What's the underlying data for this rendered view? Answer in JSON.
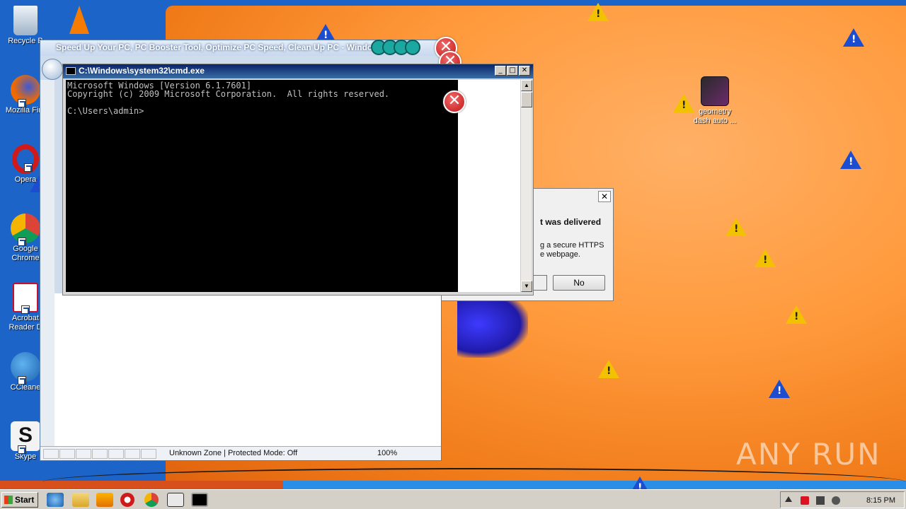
{
  "desktop": {
    "icons": [
      {
        "label": "Recycle B",
        "name": "recycle-bin"
      },
      {
        "label": "Mozilla Fire",
        "name": "firefox"
      },
      {
        "label": "Opera",
        "name": "opera"
      },
      {
        "label": "Google Chrome",
        "name": "chrome"
      },
      {
        "label": "Acrobat Reader D",
        "name": "acrobat"
      },
      {
        "label": "CCleane",
        "name": "ccleaner"
      },
      {
        "label": "Skype",
        "name": "skype"
      },
      {
        "label": "geometry dash auto ...",
        "name": "geometry-dash"
      }
    ]
  },
  "ie_window": {
    "title": "Speed Up Your PC, PC Booster Tool, Optimize PC Speed, Clean Up PC - Windows In",
    "status_zone": "Unknown Zone | Protected Mode: Off",
    "zoom": "100%"
  },
  "cmd_window": {
    "title": "C:\\Windows\\system32\\cmd.exe",
    "line1": "Microsoft Windows [Version 6.1.7601]",
    "line2": "Copyright (c) 2009 Microsoft Corporation.  All rights reserved.",
    "line3": "",
    "line4": "C:\\Users\\admin>"
  },
  "dialog": {
    "heading": "t was delivered",
    "text_line1": "g a secure HTTPS",
    "text_line2": "e webpage.",
    "no_label": "No",
    "close_glyph": "✕"
  },
  "taskbar": {
    "start_label": "Start",
    "clock": "8:15 PM"
  },
  "watermark": "ANY RUN",
  "colors": {
    "desktop_blue": "#1c64c8",
    "desktop_orange": "#ff9a3c",
    "warning_yellow": "#f2c200",
    "info_blue": "#1c4ccf",
    "error_red": "#c21616"
  }
}
